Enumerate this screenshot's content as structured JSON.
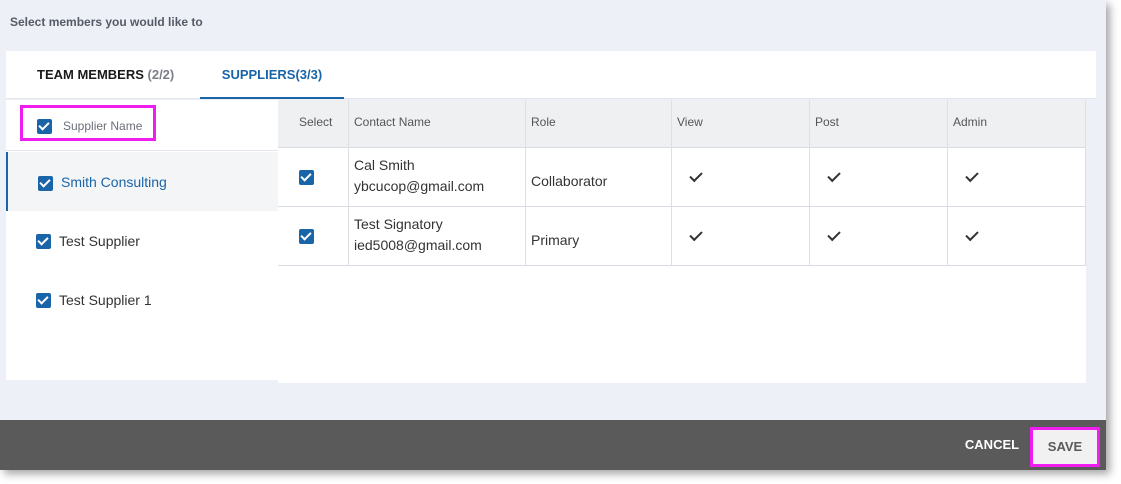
{
  "prompt": "Select members you would like to",
  "tabs": {
    "team": {
      "label": "TEAM MEMBERS",
      "count": "(2/2)"
    },
    "suppliers": {
      "label": "SUPPLIERS(3/3)"
    }
  },
  "suppliers_list": {
    "header_label": "Supplier Name",
    "items": [
      {
        "label": "Smith Consulting",
        "checked": true,
        "active": true
      },
      {
        "label": "Test Supplier",
        "checked": true,
        "active": false
      },
      {
        "label": "Test Supplier 1",
        "checked": true,
        "active": false
      }
    ]
  },
  "grid": {
    "columns": [
      "Select",
      "Contact Name",
      "Role",
      "View",
      "Post",
      "Admin"
    ],
    "rows": [
      {
        "name": "Cal Smith",
        "email": "ybcucop@gmail.com",
        "role": "Collaborator",
        "select": true,
        "view": true,
        "post": true,
        "admin": true
      },
      {
        "name": "Test Signatory",
        "email": "ied5008@gmail.com",
        "role": "Primary",
        "select": true,
        "view": true,
        "post": true,
        "admin": true
      }
    ]
  },
  "footer": {
    "cancel_label": "CANCEL",
    "save_label": "SAVE"
  },
  "colors": {
    "accent": "#1a64a8",
    "highlight": "#f01df0",
    "footer_bg": "#5a5a5a"
  },
  "icons": {
    "checkbox": "checkbox-checked-icon",
    "permission": "checkmark-icon"
  }
}
